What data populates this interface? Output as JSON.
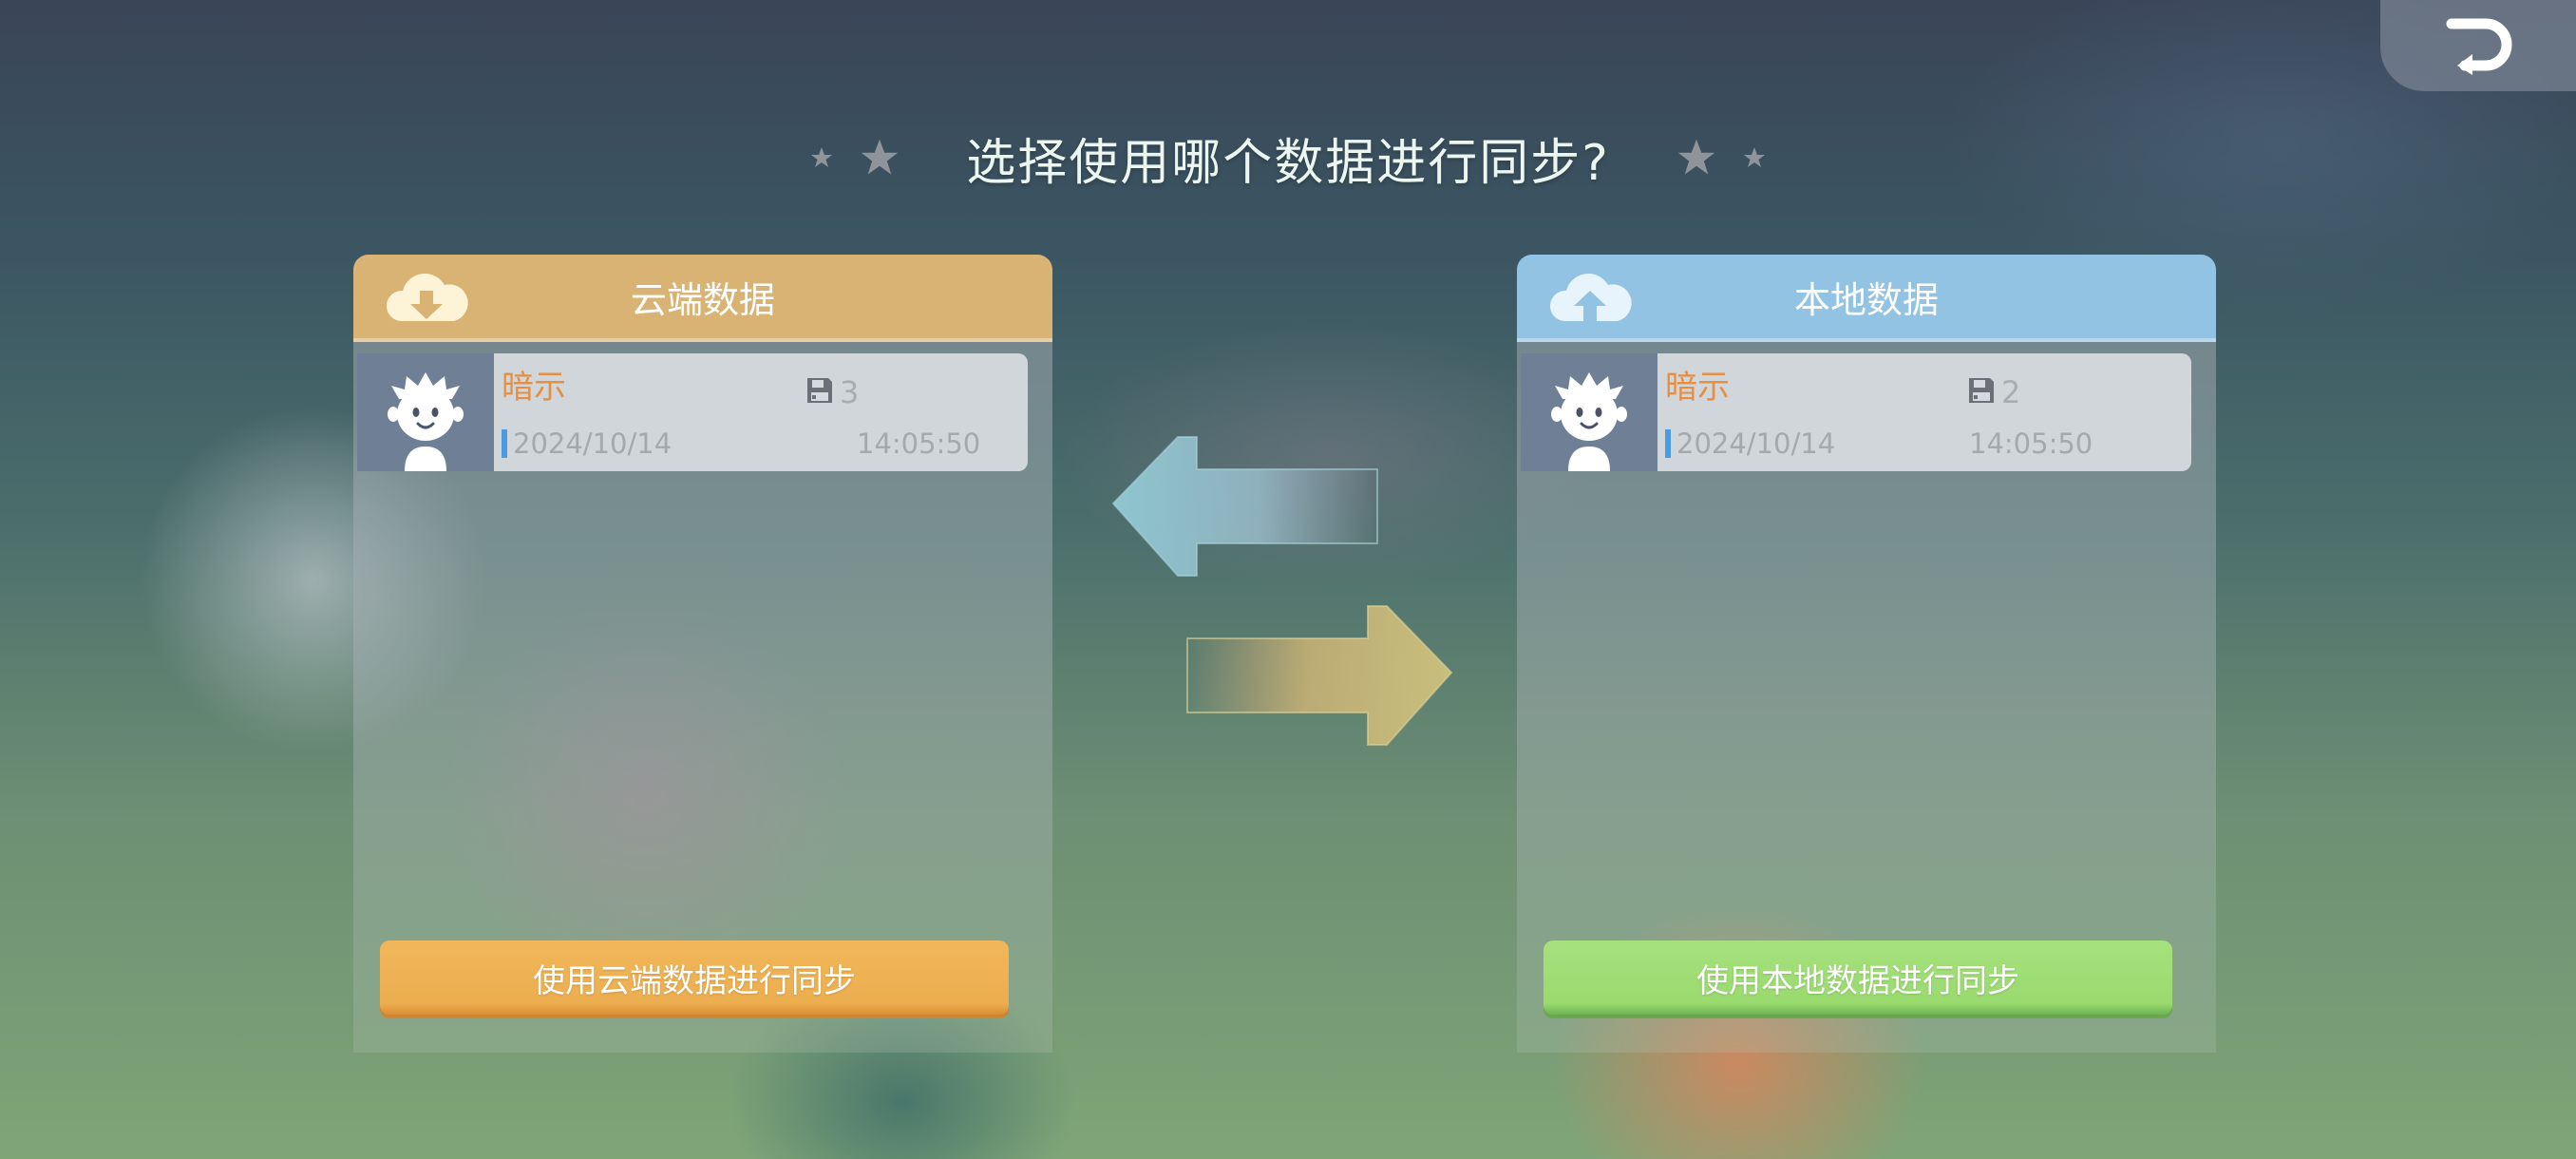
{
  "title": "选择使用哪个数据进行同步?",
  "cloud_panel": {
    "header": "云端数据",
    "header_icon": "cloud-download-icon",
    "save": {
      "name": "暗示",
      "slot": "3",
      "date": "2024/10/14",
      "time": "14:05:50"
    },
    "button": "使用云端数据进行同步"
  },
  "local_panel": {
    "header": "本地数据",
    "header_icon": "cloud-upload-icon",
    "save": {
      "name": "暗示",
      "slot": "2",
      "date": "2024/10/14",
      "time": "14:05:50"
    },
    "button": "使用本地数据进行同步"
  },
  "icons": {
    "back": "return-icon",
    "arrow_left": "arrow-left-icon",
    "arrow_right": "arrow-right-icon",
    "slot": "floppy-disk-icon",
    "avatar": "character-avatar"
  },
  "colors": {
    "cloud_accent": "#d9b374",
    "local_accent": "#93c3e3",
    "cloud_button": "#ecae4f",
    "local_button": "#99da6e",
    "save_name": "#e58f44"
  }
}
